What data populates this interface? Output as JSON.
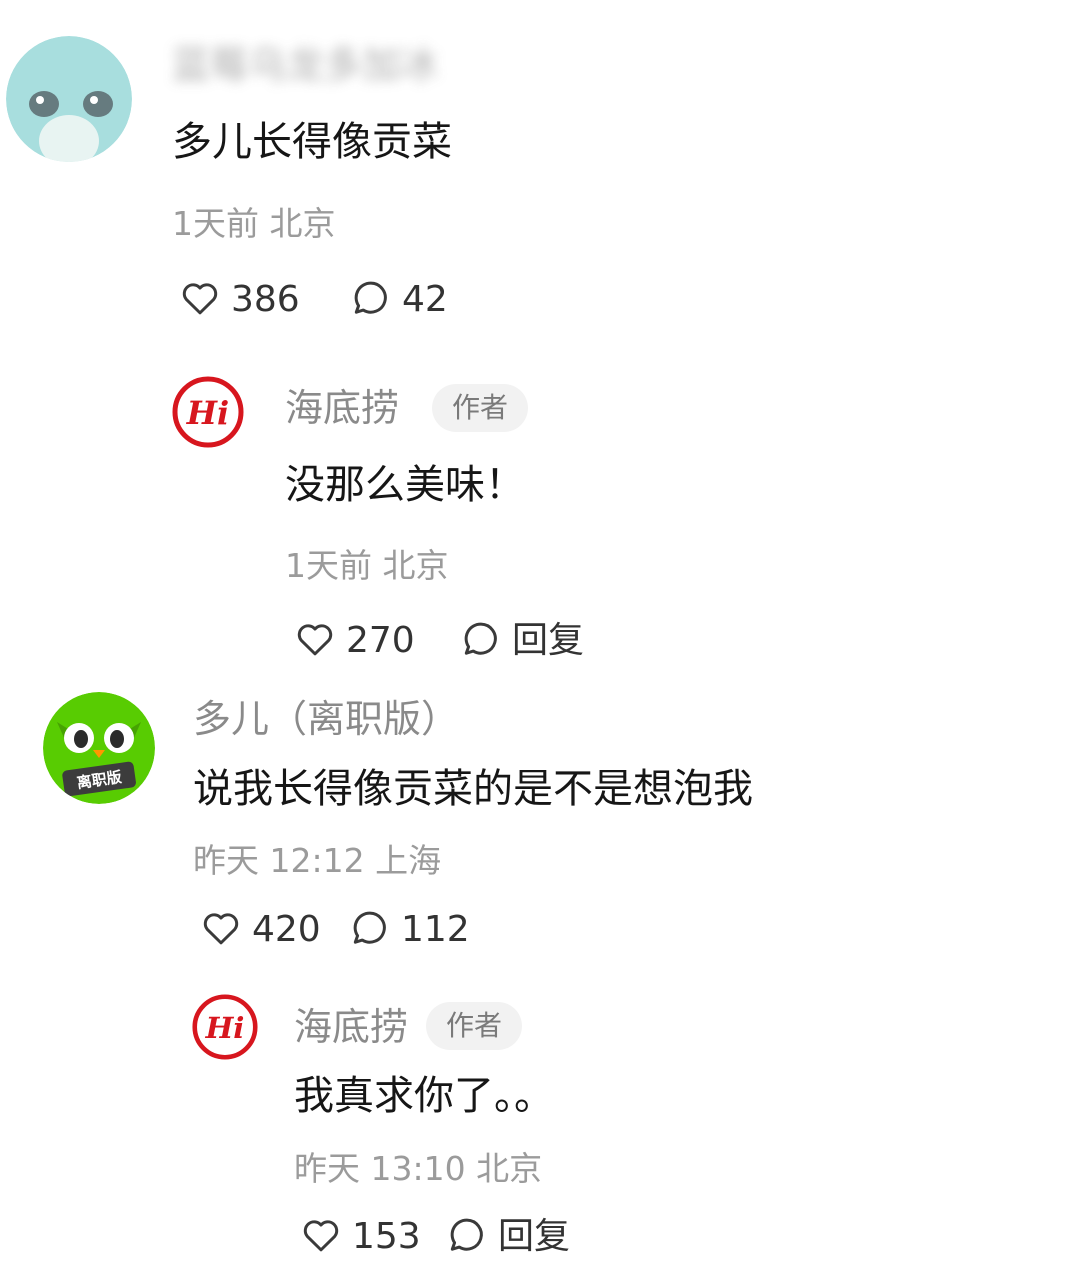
{
  "colors": {
    "text_primary": "#161616",
    "text_secondary": "#8a8a8a",
    "meta": "#9b9b9b",
    "badge_bg": "#f2f2f2",
    "hdl_red": "#d7161e",
    "duolingo_green": "#58cc02"
  },
  "comments": [
    {
      "username": "蓝莓乌龙多加冰",
      "username_blurred": true,
      "avatar_icon": "cartoon-avatar",
      "text": "多儿长得像贡菜",
      "meta": "1天前 北京",
      "likes": "386",
      "replies": "42",
      "like_icon": "heart-outline-icon",
      "reply_icon": "comment-bubble-icon"
    },
    {
      "username": "海底捞",
      "badge": "作者",
      "avatar_icon": "haidilao-hi-logo",
      "text": "没那么美味！",
      "meta": "1天前 北京",
      "likes": "270",
      "reply_label": "回复",
      "like_icon": "heart-outline-icon",
      "reply_icon": "comment-bubble-icon"
    },
    {
      "username": "多儿（离职版）",
      "avatar_icon": "duolingo-owl-avatar",
      "avatar_badge": "离职版",
      "text": "说我长得像贡菜的是不是想泡我",
      "meta": "昨天 12:12 上海",
      "likes": "420",
      "replies": "112",
      "like_icon": "heart-outline-icon",
      "reply_icon": "comment-bubble-icon"
    },
    {
      "username": "海底捞",
      "badge": "作者",
      "avatar_icon": "haidilao-hi-logo",
      "text": "我真求你了。。",
      "meta": "昨天 13:10 北京",
      "likes": "153",
      "reply_label": "回复",
      "like_icon": "heart-outline-icon",
      "reply_icon": "comment-bubble-icon"
    }
  ]
}
